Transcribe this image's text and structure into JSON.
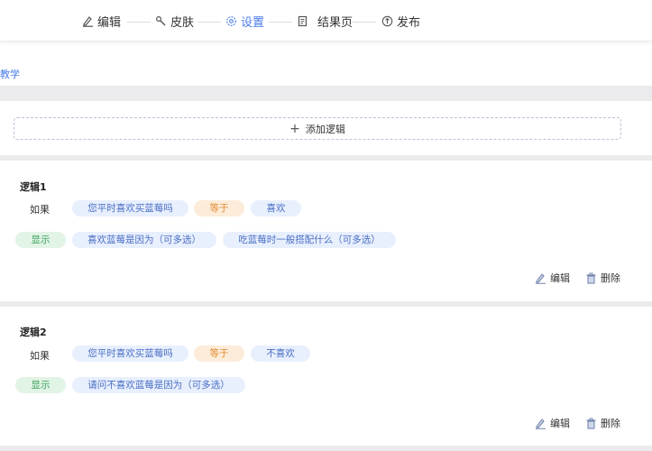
{
  "steps": [
    {
      "label": "编辑",
      "icon": "pen-icon"
    },
    {
      "label": "皮肤",
      "icon": "brush-icon"
    },
    {
      "label": "设置",
      "icon": "gear-icon"
    },
    {
      "label": "结果页",
      "icon": "document-icon"
    },
    {
      "label": "发布",
      "icon": "publish-icon"
    }
  ],
  "active_step": "设置",
  "teach_link": "教学",
  "add_logic_label": "添加逻辑",
  "logics": [
    {
      "title": "逻辑1",
      "if_label": "如果",
      "condition_question": "您平时喜欢买蓝莓吗",
      "operator": "等于",
      "condition_value": "喜欢",
      "show_label": "显示",
      "show_items": [
        "喜欢蓝莓是因为（可多选）",
        "吃蓝莓时一般搭配什么（可多选）"
      ],
      "edit_label": "编辑",
      "delete_label": "删除"
    },
    {
      "title": "逻辑2",
      "if_label": "如果",
      "condition_question": "您平时喜欢买蓝莓吗",
      "operator": "等于",
      "condition_value": "不喜欢",
      "show_label": "显示",
      "show_items": [
        "请问不喜欢蓝莓是因为（可多选）"
      ],
      "edit_label": "编辑",
      "delete_label": "删除"
    }
  ],
  "colors": {
    "accent": "#4a7ce8",
    "pill_blue_bg": "#e8effd",
    "pill_orange_bg": "#fcecd9",
    "pill_green_bg": "#e2f4e6",
    "band": "#ebebed"
  }
}
